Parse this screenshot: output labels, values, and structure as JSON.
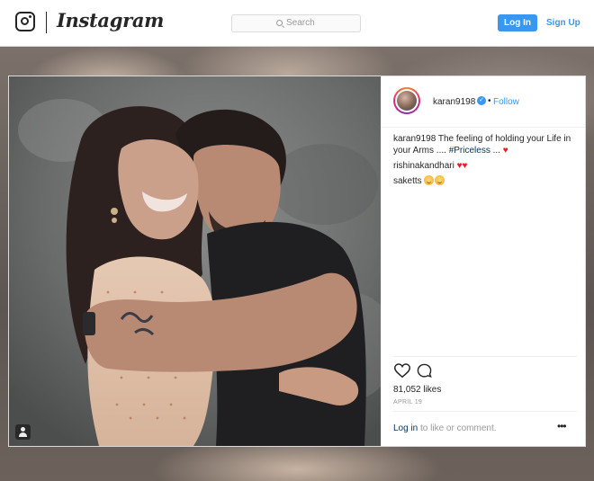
{
  "topbar": {
    "brand": "Instagram",
    "search_placeholder": "Search",
    "login_label": "Log In",
    "signup_label": "Sign Up"
  },
  "post": {
    "username": "karan9198",
    "follow_label": "Follow",
    "separator": "•",
    "caption_user": "karan9198",
    "caption_text": "The feeling of holding your Life in your Arms ....",
    "caption_hashtag": "#Priceless",
    "caption_tail": "...",
    "comments": [
      {
        "user": "rishinakandhari"
      },
      {
        "user": "saketts"
      }
    ],
    "likes": "81,052 likes",
    "date": "APRIL 19",
    "footer_login": "Log in",
    "footer_text": "to like or comment.",
    "more_label": "•••"
  },
  "colors": {
    "accent": "#3897f0",
    "heart": "#ed1c24",
    "text": "#262626",
    "muted": "#999999"
  },
  "icons": [
    "instagram-glyph-icon",
    "search-icon",
    "verified-icon",
    "heart-icon",
    "comment-icon",
    "user-tag-icon",
    "more-options-icon"
  ]
}
